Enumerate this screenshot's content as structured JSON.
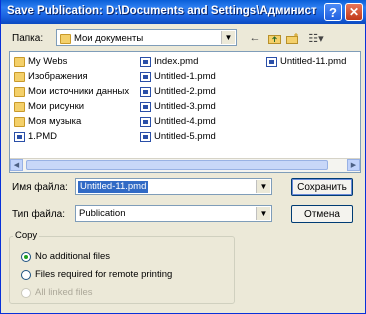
{
  "window": {
    "title": "Save Publication: D:\\Documents and Settings\\Администр..."
  },
  "titlebar_buttons": {
    "help": "?",
    "close": "✕"
  },
  "location": {
    "label": "Папка:",
    "value": "Мои документы"
  },
  "toolbar": {
    "back_icon": "←",
    "up_icon": "folder-up-icon",
    "new_folder_icon": "new-folder-icon",
    "view_icon": "☷▾"
  },
  "files": {
    "col1": [
      {
        "name": "My Webs",
        "icon": "folder"
      },
      {
        "name": "Изображения",
        "icon": "folder"
      },
      {
        "name": "Мои источники данных",
        "icon": "folder"
      },
      {
        "name": "Мои рисунки",
        "icon": "folder"
      },
      {
        "name": "Моя музыка",
        "icon": "folder"
      },
      {
        "name": "1.PMD",
        "icon": "pmd"
      }
    ],
    "col2": [
      {
        "name": "Index.pmd",
        "icon": "pmd"
      },
      {
        "name": "Untitled-1.pmd",
        "icon": "pmd"
      },
      {
        "name": "Untitled-2.pmd",
        "icon": "pmd"
      },
      {
        "name": "Untitled-3.pmd",
        "icon": "pmd"
      },
      {
        "name": "Untitled-4.pmd",
        "icon": "pmd"
      },
      {
        "name": "Untitled-5.pmd",
        "icon": "pmd"
      }
    ],
    "col3": [
      {
        "name": "Untitled-11.pmd",
        "icon": "pmd"
      }
    ]
  },
  "filename": {
    "label": "Имя файла:",
    "value": "Untitled-11.pmd"
  },
  "filetype": {
    "label": "Тип файла:",
    "value": "Publication"
  },
  "buttons": {
    "save": "Сохранить",
    "cancel": "Отмена"
  },
  "copy_group": {
    "title": "Copy",
    "options": [
      {
        "label": "No additional files",
        "selected": true,
        "enabled": true
      },
      {
        "label": "Files required for remote printing",
        "selected": false,
        "enabled": true
      },
      {
        "label": "All linked files",
        "selected": false,
        "enabled": false
      }
    ]
  }
}
